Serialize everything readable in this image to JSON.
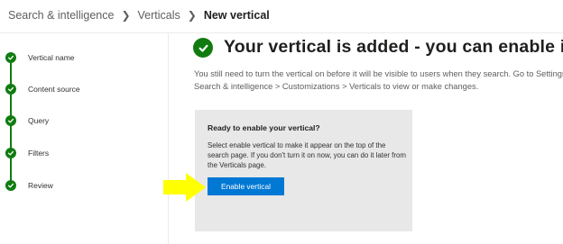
{
  "breadcrumb": {
    "items": [
      "Search & intelligence",
      "Verticals"
    ],
    "current": "New vertical",
    "separator_icon": "chevron-right-icon"
  },
  "steps": [
    {
      "label": "Vertical name",
      "status": "completed"
    },
    {
      "label": "Content source",
      "status": "completed"
    },
    {
      "label": "Query",
      "status": "completed"
    },
    {
      "label": "Filters",
      "status": "completed"
    },
    {
      "label": "Review",
      "status": "completed"
    }
  ],
  "main": {
    "title": "Your vertical is added - you can enable it",
    "description": "You still need to turn the vertical on before it will be visible to users when they search. Go to Settings > Search & intelligence > Customizations > Verticals to view or make changes.",
    "card": {
      "title": "Ready to enable your vertical?",
      "body": "Select enable vertical to make it appear on the top of the search page. If you don't turn it on now, you can do it later from the Verticals page.",
      "button_label": "Enable vertical"
    }
  },
  "colors": {
    "success": "#107c10",
    "primary": "#0078d4",
    "card_bg": "#e8e8e8",
    "annotation_arrow": "#ffff00"
  },
  "icons": {
    "step": "checkmark-circle-icon",
    "title": "checkmark-circle-icon",
    "annotation": "yellow-arrow-icon"
  }
}
